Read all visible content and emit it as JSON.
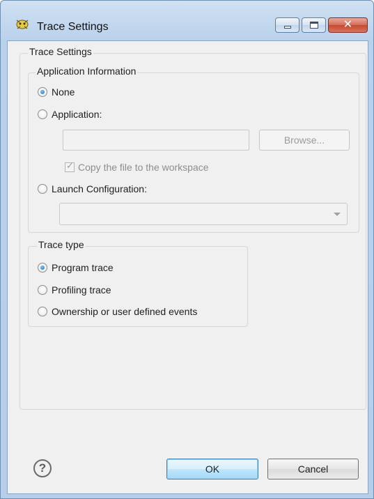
{
  "window": {
    "title": "Trace Settings",
    "minimize_icon": "minimize-icon",
    "maximize_icon": "maximize-icon",
    "close_glyph": "✕"
  },
  "main": {
    "group_title": "Trace Settings",
    "app_info": {
      "title": "Application Information",
      "options": [
        {
          "label": "None",
          "selected": true
        },
        {
          "label": "Application:",
          "selected": false
        },
        {
          "label": "Launch Configuration:",
          "selected": false
        }
      ],
      "application_path": "",
      "browse_label": "Browse...",
      "copy_label": "Copy the file to the workspace",
      "copy_checked": true,
      "launch_config_value": ""
    },
    "trace_type": {
      "title": "Trace type",
      "options": [
        {
          "label": "Program trace",
          "selected": true
        },
        {
          "label": "Profiling trace",
          "selected": false
        },
        {
          "label": "Ownership or user defined events",
          "selected": false
        }
      ]
    }
  },
  "footer": {
    "help_glyph": "?",
    "ok_label": "OK",
    "cancel_label": "Cancel"
  }
}
